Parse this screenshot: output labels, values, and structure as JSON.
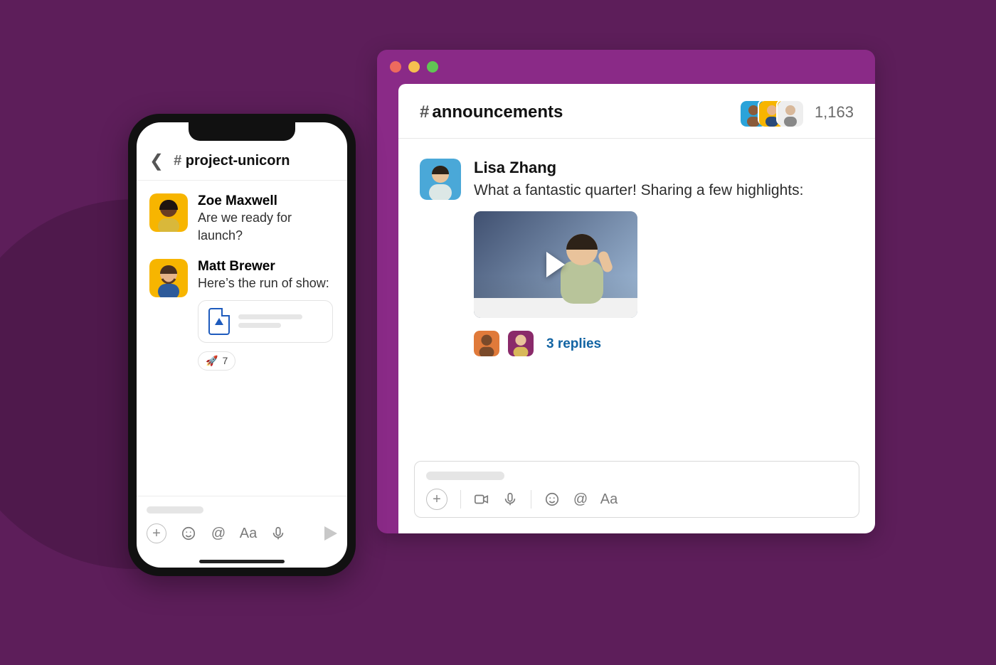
{
  "desktop": {
    "channel_hash": "#",
    "channel_name": "announcements",
    "member_count": "1,163",
    "message": {
      "author": "Lisa Zhang",
      "text": "What a fantastic quarter! Sharing a few highlights:",
      "replies_label": "3 replies"
    },
    "composer_icons": {
      "video": "video-icon",
      "mic": "mic-icon",
      "emoji": "emoji-icon",
      "mention": "@",
      "format": "Aa"
    }
  },
  "mobile": {
    "channel_hash": "#",
    "channel_name": "project-unicorn",
    "messages": [
      {
        "author": "Zoe Maxwell",
        "text": "Are we ready for launch?"
      },
      {
        "author": "Matt Brewer",
        "text": "Here’s the run of show:"
      }
    ],
    "reaction": {
      "emoji": "🚀",
      "count": "7"
    },
    "composer_icons": {
      "emoji": "emoji-icon",
      "mention": "@",
      "format": "Aa",
      "mic": "mic-icon"
    }
  },
  "colors": {
    "avatar_bg": [
      "#2aa3d9",
      "#f7b500",
      "#d66f9c",
      "#8fa",
      "#f7b500",
      "#b04a8a"
    ]
  }
}
